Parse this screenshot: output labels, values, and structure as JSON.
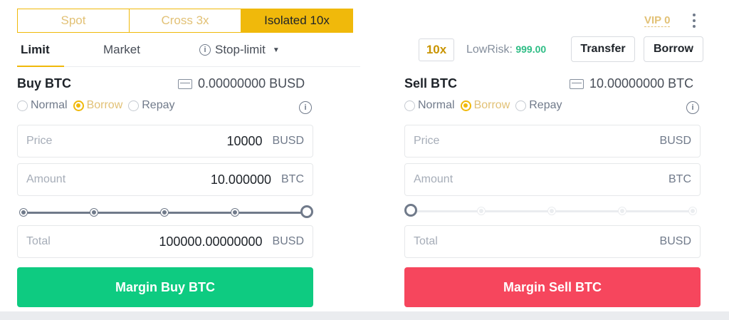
{
  "mode_tabs": [
    "Spot",
    "Cross 3x",
    "Isolated 10x"
  ],
  "order_tabs": {
    "limit": "Limit",
    "market": "Market",
    "stop_limit": "Stop-limit"
  },
  "header_right": {
    "vip": "VIP 0",
    "leverage": "10x",
    "lowrisk_label": "LowRisk:",
    "lowrisk_value": "999.00",
    "transfer": "Transfer",
    "borrow": "Borrow"
  },
  "buy": {
    "title": "Buy BTC",
    "balance": "0.00000000 BUSD",
    "radios": [
      "Normal",
      "Borrow",
      "Repay"
    ],
    "selected_radio": "Borrow",
    "price_label": "Price",
    "price_value": "10000",
    "price_unit": "BUSD",
    "amount_label": "Amount",
    "amount_value": "10.000000",
    "amount_unit": "BTC",
    "slider_fraction": 1.0,
    "total_label": "Total",
    "total_value": "100000.00000000",
    "total_unit": "BUSD",
    "button": "Margin Buy BTC"
  },
  "sell": {
    "title": "Sell BTC",
    "balance": "10.00000000 BTC",
    "radios": [
      "Normal",
      "Borrow",
      "Repay"
    ],
    "selected_radio": "Borrow",
    "price_label": "Price",
    "price_unit": "BUSD",
    "amount_label": "Amount",
    "amount_unit": "BTC",
    "slider_fraction": 0.0,
    "total_label": "Total",
    "total_unit": "BUSD",
    "button": "Margin Sell BTC"
  },
  "colors": {
    "accent": "#f0b90b",
    "buy": "#0ecb81",
    "sell": "#f6465d"
  },
  "icons": [
    "wallet-icon",
    "info-icon",
    "chevron-down-icon",
    "kebab-menu-icon"
  ]
}
